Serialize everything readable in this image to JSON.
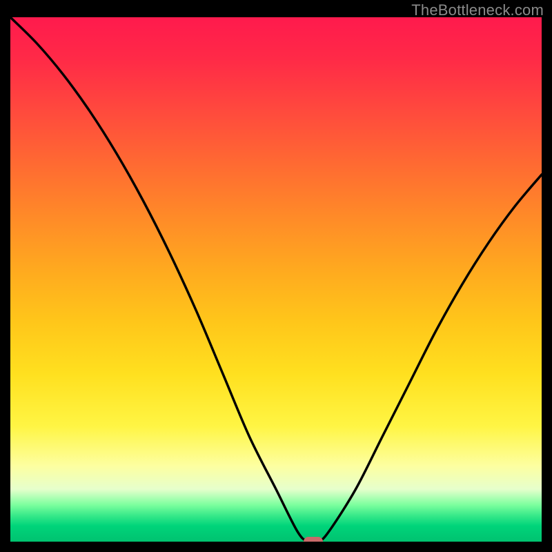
{
  "watermark": "TheBottleneck.com",
  "colors": {
    "background": "#000000",
    "curve": "#000000",
    "marker": "#c96a6a",
    "gradient_top": "#ff1a4d",
    "gradient_bottom": "#00c270"
  },
  "chart_data": {
    "type": "line",
    "title": "",
    "xlabel": "",
    "ylabel": "",
    "xlim": [
      0,
      100
    ],
    "ylim": [
      0,
      100
    ],
    "grid": false,
    "legend": false,
    "series": [
      {
        "name": "bottleneck-curve",
        "x": [
          0,
          5,
          10,
          15,
          20,
          25,
          30,
          35,
          40,
          45,
          50,
          54,
          56,
          58,
          60,
          65,
          70,
          75,
          80,
          85,
          90,
          95,
          100
        ],
        "values": [
          100,
          95,
          89,
          82,
          74,
          65,
          55,
          44,
          32,
          20,
          10,
          2,
          0,
          0,
          2,
          10,
          20,
          30,
          40,
          49,
          57,
          64,
          70
        ]
      }
    ],
    "marker": {
      "x": 57,
      "y": 0,
      "shape": "pill"
    },
    "background_gradient_stops": [
      {
        "pos": 0.0,
        "color": "#ff1a4d"
      },
      {
        "pos": 0.5,
        "color": "#ffc61a"
      },
      {
        "pos": 0.85,
        "color": "#fdffa0"
      },
      {
        "pos": 0.93,
        "color": "#7cff9e"
      },
      {
        "pos": 1.0,
        "color": "#00c270"
      }
    ]
  }
}
